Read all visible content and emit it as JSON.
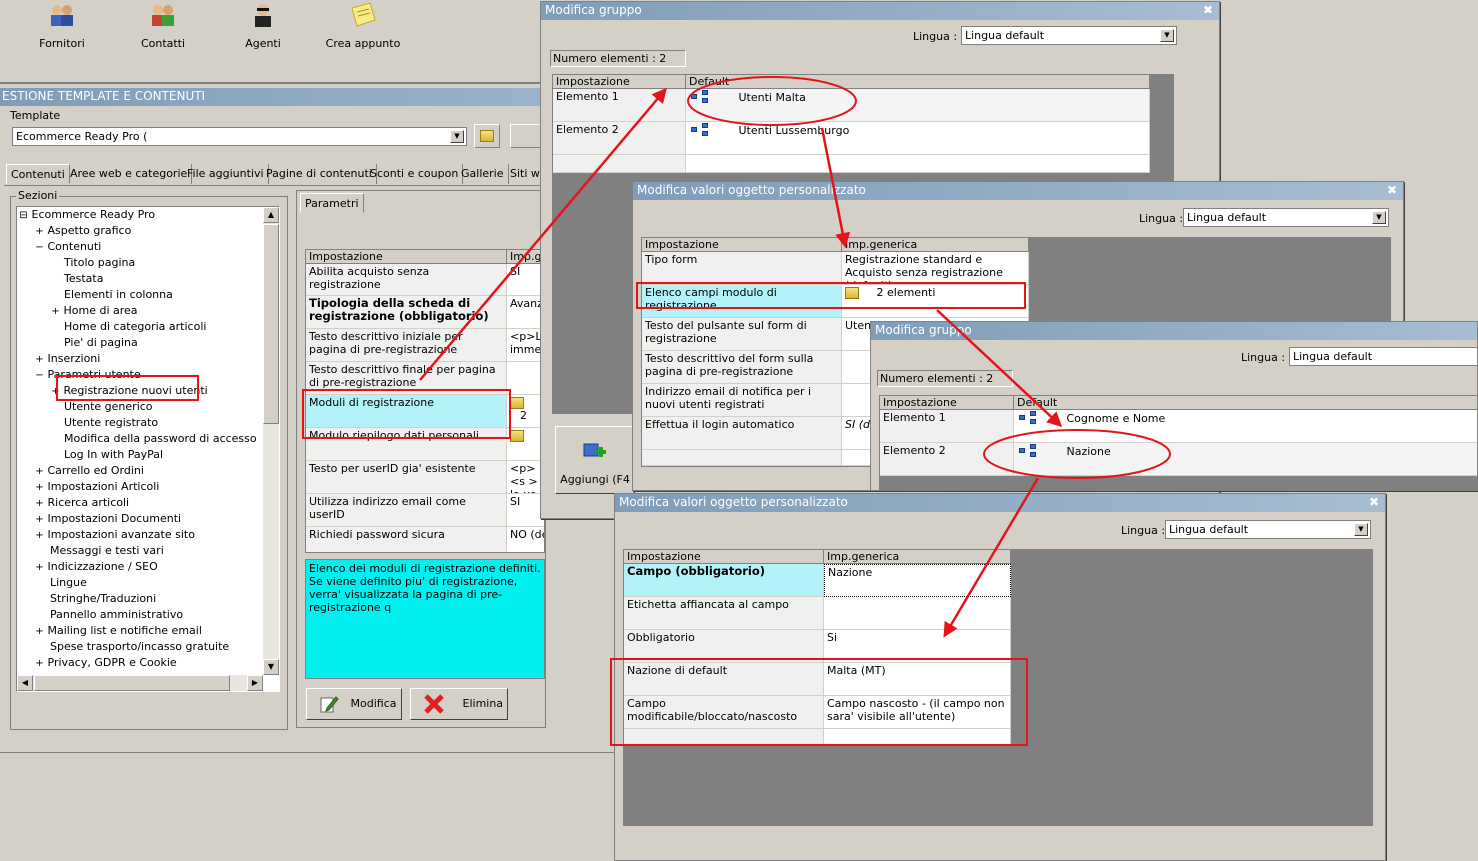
{
  "toolbar": {
    "items": [
      {
        "label": "Fornitori",
        "icon": "suppliers-icon"
      },
      {
        "label": "Contatti",
        "icon": "contacts-icon"
      },
      {
        "label": "Agenti",
        "icon": "agent-icon"
      },
      {
        "label": "Crea appunto",
        "icon": "note-icon"
      }
    ]
  },
  "main": {
    "title": "ESTIONE TEMPLATE E CONTENUTI",
    "template_label": "Template",
    "template_value": "Ecommerce Ready Pro (",
    "tabs": [
      "Contenuti",
      "Aree web e categorie",
      "File aggiuntivi",
      "Pagine di contenuti",
      "Sconti e coupon",
      "Gallerie",
      "Siti we"
    ],
    "sections_label": "Sezioni",
    "tree": [
      "Ecommerce Ready Pro",
      "Aspetto grafico",
      "Contenuti",
      "Titolo pagina",
      "Testata",
      "Elementi in colonna",
      "Home di area",
      "Home di categoria articoli",
      "Pie' di pagina",
      "Inserzioni",
      "Parametri utente",
      "Registrazione nuovi utenti",
      "Utente generico",
      "Utente registrato",
      "Modifica della password di accesso",
      "Log In with PayPal",
      "Carrello ed Ordini",
      "Impostazioni Articoli",
      "Ricerca articoli",
      "Impostazioni Documenti",
      "Impostazioni avanzate sito",
      "Messaggi e testi vari",
      "Indicizzazione / SEO",
      "Lingue",
      "Stringhe/Traduzioni",
      "Pannello amministrativo",
      "Mailing list e notifiche email",
      "Spese trasporto/incasso gratuite",
      "Privacy, GDPR e Cookie"
    ],
    "params_tab": "Parametri",
    "grid_headers": [
      "Impostazione",
      "Imp.ge"
    ],
    "rows": [
      {
        "label": "Abilita acquisto senza registrazione",
        "value": "SI"
      },
      {
        "label": "Tipologia della scheda di registrazione (obbligatorio)",
        "value": "Avanz"
      },
      {
        "label": "Testo descrittivo iniziale per pagina di pre-registrazione",
        "value": "<p>La immedi"
      },
      {
        "label": "Testo descrittivo finale per pagina di pre-registrazione",
        "value": ""
      },
      {
        "label": "Moduli di registrazione",
        "value": "2"
      },
      {
        "label": "Modulo riepilogo dati personali",
        "value": ""
      },
      {
        "label": "Testo per userID gia' esistente",
        "value": "<p><s > lo us"
      },
      {
        "label": "Utilizza indirizzo email come userID",
        "value": "SI"
      },
      {
        "label": "Richiedi password sicura",
        "value": "NO (default)"
      }
    ],
    "description": "Elenco dei moduli di registrazione definiti. Se viene definito piu' di registrazione, verra' visualizzata la pagina di pre-registrazione q",
    "btn_modifica": "Modifica",
    "btn_elimina": "Elimina"
  },
  "dlg1": {
    "title": "Modifica gruppo",
    "lingua_label": "Lingua :",
    "lingua_value": "Lingua default",
    "count": "Numero elementi : 2",
    "headers": [
      "Impostazione",
      "Default"
    ],
    "rows": [
      {
        "label": "Elemento 1",
        "value": "Utenti Malta"
      },
      {
        "label": "Elemento 2",
        "value": "Utenti Lussemburgo"
      }
    ],
    "add_label": "Aggiungi (F4"
  },
  "dlg2": {
    "title": "Modifica valori oggetto personalizzato",
    "lingua_label": "Lingua :",
    "lingua_value": "Lingua default",
    "headers": [
      "Impostazione",
      "Imp.generica"
    ],
    "rows": [
      {
        "label": "Tipo form",
        "value": "Registrazione standard e Acquisto senza registrazione (default)"
      },
      {
        "label": "Elenco campi modulo di registrazione",
        "value": "2 elementi"
      },
      {
        "label": "Testo del pulsante sul form di registrazione",
        "value": "Utent"
      },
      {
        "label": "Testo descrittivo del form sulla pagina di pre-registrazione",
        "value": ""
      },
      {
        "label": "Indirizzo email di notifica per i nuovi utenti registrati",
        "value": ""
      },
      {
        "label": "Effettua il login automatico",
        "value": "SI (d"
      }
    ]
  },
  "dlg3": {
    "title": "Modifica gruppo",
    "lingua_label": "Lingua :",
    "lingua_value": "Lingua default",
    "count": "Numero elementi : 2",
    "headers": [
      "Impostazione",
      "Default"
    ],
    "rows": [
      {
        "label": "Elemento 1",
        "value": "Cognome e Nome"
      },
      {
        "label": "Elemento 2",
        "value": "Nazione"
      }
    ]
  },
  "dlg4": {
    "title": "Modifica valori oggetto personalizzato",
    "lingua_label": "Lingua :",
    "lingua_value": "Lingua default",
    "headers": [
      "Impostazione",
      "Imp.generica"
    ],
    "rows": [
      {
        "label": "Campo (obbligatorio)",
        "value": "Nazione"
      },
      {
        "label": "Etichetta affiancata al campo",
        "value": ""
      },
      {
        "label": "Obbligatorio",
        "value": "Si"
      },
      {
        "label": "Nazione di default",
        "value": "Malta (MT)"
      },
      {
        "label": "Campo modificabile/bloccato/nascosto",
        "value": "Campo nascosto - (il campo non sara' visibile all'utente)"
      }
    ]
  },
  "colors": {
    "annotation": "#e4141b",
    "selected_row": "#b3f2f8",
    "description_bg": "#00f0f0",
    "titlebar": "#7f9db9"
  }
}
